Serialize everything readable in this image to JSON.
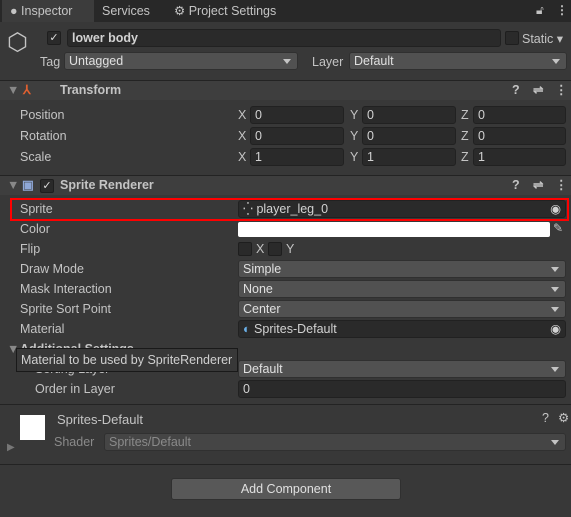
{
  "tabs": [
    {
      "label": "Inspector",
      "icon": "info-icon"
    },
    {
      "label": "Services"
    },
    {
      "label": "Project Settings",
      "icon": "gear-icon"
    }
  ],
  "object": {
    "name": "lower body",
    "active": true,
    "static_label": "Static",
    "tag_label": "Tag",
    "tag": "Untagged",
    "layer_label": "Layer",
    "layer": "Default"
  },
  "transform": {
    "title": "Transform",
    "rows": [
      {
        "label": "Position",
        "x": "0",
        "y": "0",
        "z": "0"
      },
      {
        "label": "Rotation",
        "x": "0",
        "y": "0",
        "z": "0"
      },
      {
        "label": "Scale",
        "x": "1",
        "y": "1",
        "z": "1"
      }
    ],
    "axes": [
      "X",
      "Y",
      "Z"
    ]
  },
  "sprite_renderer": {
    "title": "Sprite Renderer",
    "enabled": true,
    "sprite_label": "Sprite",
    "sprite": "player_leg_0",
    "color_label": "Color",
    "color": "#ffffff",
    "flip_label": "Flip",
    "flip_x": "X",
    "flip_y": "Y",
    "draw_mode_label": "Draw Mode",
    "draw_mode": "Simple",
    "mask_label": "Mask Interaction",
    "mask": "None",
    "sort_point_label": "Sprite Sort Point",
    "sort_point": "Center",
    "material_label": "Material",
    "material": "Sprites-Default",
    "additional_label": "Additional Settings",
    "sorting_layer_label": "Sorting Layer",
    "sorting_layer": "Default",
    "order_label": "Order in Layer",
    "order": "0"
  },
  "tooltip": "Material to be used by SpriteRenderer",
  "material": {
    "name": "Sprites-Default",
    "shader_label": "Shader",
    "shader": "Sprites/Default"
  },
  "add_component": "Add Component",
  "highlight_color": "#ff0000"
}
